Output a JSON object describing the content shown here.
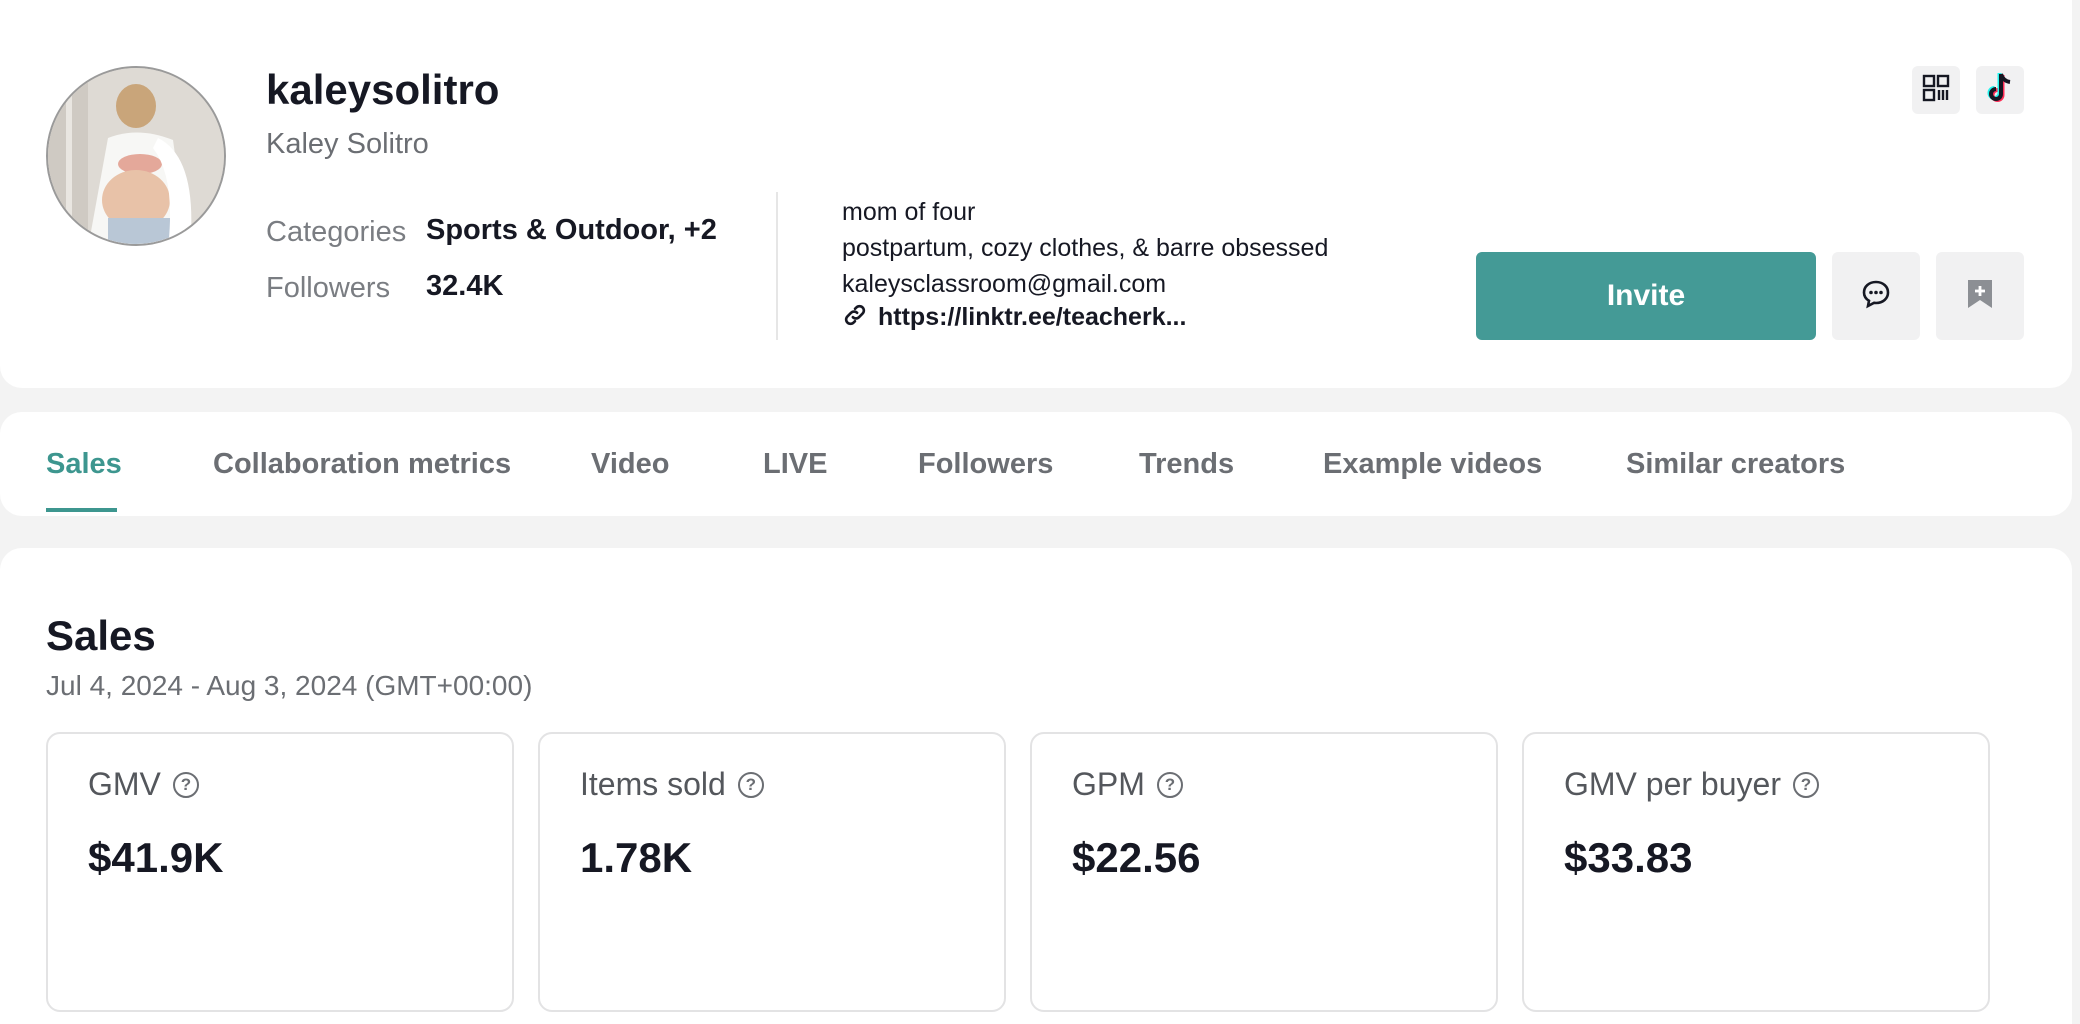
{
  "profile": {
    "username": "kaleysolitro",
    "display_name": "Kaley Solitro",
    "categories_label": "Categories",
    "categories_value": "Sports & Outdoor, +2",
    "followers_label": "Followers",
    "followers_value": "32.4K",
    "bio": {
      "line1": "mom of four",
      "line2": "postpartum, cozy clothes, & barre obsessed",
      "line3": "kaleysclassroom@gmail.com",
      "link": "https://linktr.ee/teacherk..."
    },
    "actions": {
      "invite_label": "Invite"
    },
    "icons": {
      "qr": "qr-code-icon",
      "tiktok": "tiktok-logo-icon",
      "message": "chat-bubble-icon",
      "save": "bookmark-plus-icon",
      "link": "link-icon"
    },
    "accent_color": "#449a96"
  },
  "tabs": [
    {
      "label": "Sales",
      "active": true
    },
    {
      "label": "Collaboration metrics"
    },
    {
      "label": "Video"
    },
    {
      "label": "LIVE"
    },
    {
      "label": "Followers"
    },
    {
      "label": "Trends"
    },
    {
      "label": "Example videos"
    },
    {
      "label": "Similar creators"
    }
  ],
  "sales": {
    "title": "Sales",
    "date_range": "Jul 4, 2024 - Aug 3, 2024 (GMT+00:00)",
    "metrics": [
      {
        "label": "GMV",
        "value": "$41.9K"
      },
      {
        "label": "Items sold",
        "value": "1.78K"
      },
      {
        "label": "GPM",
        "value": "$22.56"
      },
      {
        "label": "GMV per buyer",
        "value": "$33.83"
      }
    ],
    "help_glyph": "?"
  }
}
